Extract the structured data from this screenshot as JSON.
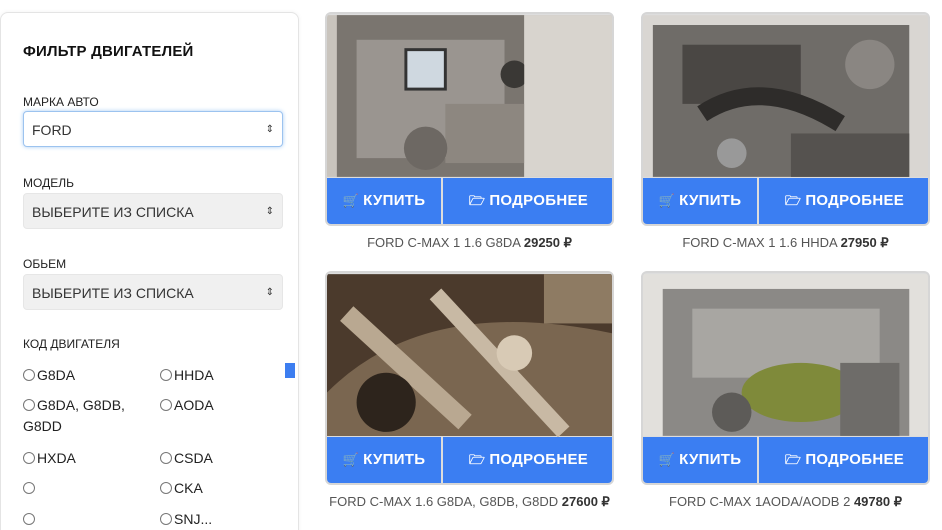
{
  "filter": {
    "title": "ФИЛЬТР ДВИГАТЕЛЕЙ",
    "brand_label": "МАРКА АВТО",
    "brand_value": "FORD",
    "model_label": "МОДЕЛЬ",
    "model_value": "ВЫБЕРИТЕ ИЗ СПИСКА",
    "volume_label": "ОБЬЕМ",
    "volume_value": "ВЫБЕРИТЕ ИЗ СПИСКА",
    "code_label": "КОД ДВИГАТЕЛЯ",
    "codes": [
      "G8DA",
      "HHDA",
      "G8DA, G8DB,",
      "G8DD",
      "AODA",
      "HXDA",
      "CSDA",
      "",
      "CKA",
      "",
      "SNJ..."
    ]
  },
  "products": [
    {
      "buy": "КУПИТЬ",
      "more": "ПОДРОБНЕЕ",
      "name": "FORD C-MAX 1 1.6 G8DA",
      "price": "29250 ₽"
    },
    {
      "buy": "КУПИТЬ",
      "more": "ПОДРОБНЕЕ",
      "name": "FORD C-MAX 1 1.6 HHDA",
      "price": "27950 ₽"
    },
    {
      "buy": "КУПИТЬ",
      "more": "ПОДРОБНЕЕ",
      "name": "FORD C-MAX 1.6 G8DA, G8DB, G8DD",
      "price": "27600 ₽"
    },
    {
      "buy": "КУПИТЬ",
      "more": "ПОДРОБНЕЕ",
      "name": "FORD C-MAX 1AODA/AODB 2",
      "price": "49780 ₽"
    }
  ],
  "colors": {
    "accent": "#3b7ef2",
    "select_focus": "#9cc3ef"
  }
}
